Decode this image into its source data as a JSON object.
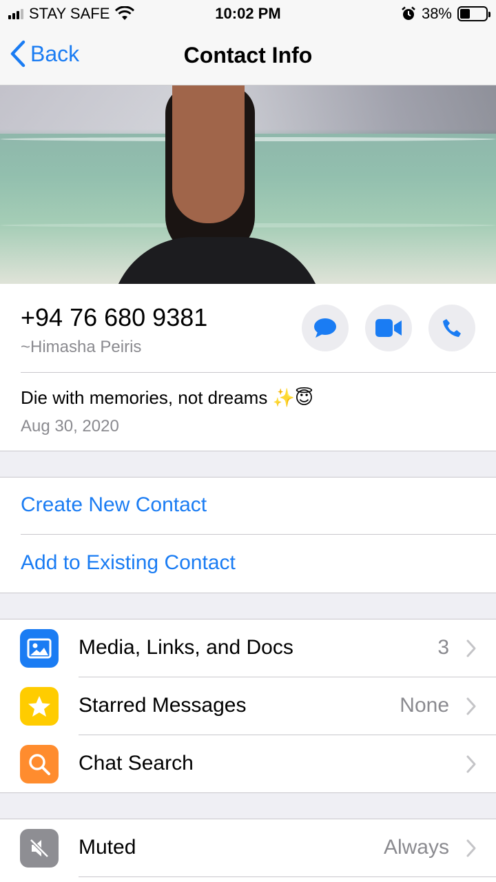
{
  "status_bar": {
    "carrier": "STAY SAFE",
    "time": "10:02 PM",
    "battery": "38%",
    "battery_level": 0.38,
    "icons": [
      "signal-icon",
      "wifi-icon",
      "alarm-icon",
      "battery-icon"
    ]
  },
  "nav": {
    "back_label": "Back",
    "title": "Contact Info"
  },
  "profile": {
    "phone": "+94 76 680 9381",
    "name": "~Himasha Peiris",
    "about": "Die with memories, not dreams ✨😇",
    "about_date": "Aug 30, 2020",
    "actions": [
      "message-icon",
      "video-call-icon",
      "voice-call-icon"
    ]
  },
  "contact_actions": {
    "create": "Create New Contact",
    "add_existing": "Add to Existing Contact"
  },
  "menu": {
    "items": [
      {
        "label": "Media, Links, and Docs",
        "value": "3",
        "icon": "media-icon",
        "color": "#1a7cf3"
      },
      {
        "label": "Starred Messages",
        "value": "None",
        "icon": "star-icon",
        "color": "#ffcc00"
      },
      {
        "label": "Chat Search",
        "value": "",
        "icon": "search-icon",
        "color": "#ff8c2e"
      }
    ]
  },
  "settings": {
    "muted_label": "Muted",
    "muted_value": "Always",
    "muted_icon": "mute-icon",
    "muted_color": "#8e8e93"
  },
  "colors": {
    "accent": "#1a7cf3",
    "secondary_text": "#8a8a8f",
    "background": "#efeff4"
  }
}
